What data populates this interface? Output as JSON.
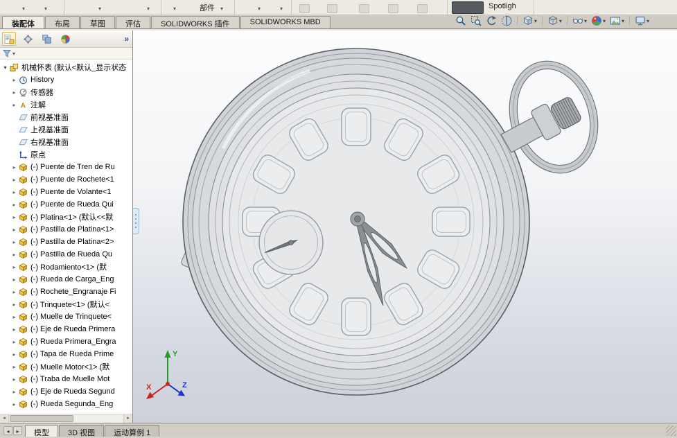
{
  "icons": {
    "caret": "▾",
    "chevrons": "»",
    "tab_prev": "◂",
    "tab_next": "▸"
  },
  "ribbon_partial": {
    "component_label": "部件",
    "spotlight_label": "Spotligh"
  },
  "command_tabs": {
    "tabs": [
      {
        "label": "装配体",
        "active": true
      },
      {
        "label": "布局"
      },
      {
        "label": "草图"
      },
      {
        "label": "评估"
      },
      {
        "label": "SOLIDWORKS 插件"
      },
      {
        "label": "SOLIDWORKS MBD"
      }
    ]
  },
  "view_toolbar": {
    "items": [
      {
        "icon": "zoom-fit"
      },
      {
        "icon": "zoom-area"
      },
      {
        "icon": "previous-view"
      },
      {
        "icon": "section-view"
      },
      {
        "sep": true
      },
      {
        "icon": "view-orientation",
        "caret": "▾"
      },
      {
        "sep": true
      },
      {
        "icon": "display-style",
        "caret": "▾"
      },
      {
        "sep": true
      },
      {
        "icon": "hide-show",
        "caret": "▾"
      },
      {
        "icon": "appearance",
        "caret": "▾"
      },
      {
        "icon": "scene",
        "caret": "▾"
      },
      {
        "sep": true
      },
      {
        "icon": "view-settings",
        "caret": "▾"
      }
    ]
  },
  "feature_panel": {
    "toolbar_icons": [
      {
        "icon": "pt-features",
        "active": true
      },
      {
        "icon": "pt-properties"
      },
      {
        "icon": "pt-configurations"
      },
      {
        "icon": "pt-display"
      }
    ],
    "tree": [
      {
        "label": "机械怀表 (默认<默认_显示状态",
        "icon": "assembly",
        "exp": "open",
        "cls": "lvl0"
      },
      {
        "label": "History",
        "icon": "history",
        "exp": "closed",
        "cls": "lvl1"
      },
      {
        "label": "传感器",
        "icon": "sensors",
        "exp": "closed",
        "cls": "lvl1"
      },
      {
        "label": "注解",
        "icon": "annotations",
        "exp": "closed",
        "cls": "lvl1"
      },
      {
        "label": "前视基准面",
        "icon": "plane",
        "exp": "none",
        "cls": "lvl1"
      },
      {
        "label": "上视基准面",
        "icon": "plane",
        "exp": "none",
        "cls": "lvl1"
      },
      {
        "label": "右视基准面",
        "icon": "plane",
        "exp": "none",
        "cls": "lvl1"
      },
      {
        "label": "原点",
        "icon": "origin",
        "exp": "none",
        "cls": "lvl1"
      },
      {
        "label": "(-) Puente de Tren de Ru",
        "icon": "part",
        "exp": "closed",
        "cls": "lvl1"
      },
      {
        "label": "(-) Puente de Rochete<1",
        "icon": "part",
        "exp": "closed",
        "cls": "lvl1"
      },
      {
        "label": "(-) Puente de Volante<1",
        "icon": "part",
        "exp": "closed",
        "cls": "lvl1"
      },
      {
        "label": "(-) Puente de Rueda Qui",
        "icon": "part",
        "exp": "closed",
        "cls": "lvl1"
      },
      {
        "label": "(-) Platina<1> (默认<<默",
        "icon": "part",
        "exp": "closed",
        "cls": "lvl1"
      },
      {
        "label": "(-) Pastilla de Platina<1>",
        "icon": "part",
        "exp": "closed",
        "cls": "lvl1"
      },
      {
        "label": "(-) Pastilla de Platina<2>",
        "icon": "part",
        "exp": "closed",
        "cls": "lvl1"
      },
      {
        "label": "(-) Pastilla de Rueda Qu",
        "icon": "part",
        "exp": "closed",
        "cls": "lvl1"
      },
      {
        "label": "(-) Rodamiento<1> (默",
        "icon": "part",
        "exp": "closed",
        "cls": "lvl1"
      },
      {
        "label": "(-) Rueda de Carga_Eng",
        "icon": "part",
        "exp": "closed",
        "cls": "lvl1"
      },
      {
        "label": "(-) Rochete_Engranaje Fi",
        "icon": "part",
        "exp": "closed",
        "cls": "lvl1"
      },
      {
        "label": "(-) Trinquete<1> (默认<",
        "icon": "part",
        "exp": "closed",
        "cls": "lvl1"
      },
      {
        "label": "(-) Muelle de Trinquete<",
        "icon": "part",
        "exp": "closed",
        "cls": "lvl1"
      },
      {
        "label": "(-) Eje de Rueda Primera",
        "icon": "part",
        "exp": "closed",
        "cls": "lvl1"
      },
      {
        "label": "(-) Rueda Primera_Engra",
        "icon": "part",
        "exp": "closed",
        "cls": "lvl1"
      },
      {
        "label": "(-) Tapa de Rueda Prime",
        "icon": "part",
        "exp": "closed",
        "cls": "lvl1"
      },
      {
        "label": "(-) Muelle Motor<1> (默",
        "icon": "part",
        "exp": "closed",
        "cls": "lvl1"
      },
      {
        "label": "(-) Traba de Muelle Mot",
        "icon": "part",
        "exp": "closed",
        "cls": "lvl1"
      },
      {
        "label": "(-) Eje de Rueda Segund",
        "icon": "part",
        "exp": "closed",
        "cls": "lvl1"
      },
      {
        "label": "(-) Rueda Segunda_Eng",
        "icon": "part",
        "exp": "closed",
        "cls": "lvl1"
      }
    ]
  },
  "viewport": {
    "triad": {
      "x_label": "X",
      "y_label": "Y",
      "z_label": "Z",
      "x_color": "#cc2222",
      "y_color": "#1f9e1f",
      "z_color": "#2233cc"
    }
  },
  "status_bar": {
    "tabs": [
      {
        "label": "模型",
        "active": true
      },
      {
        "label": "3D 视图"
      },
      {
        "label": "运动算例 1"
      }
    ]
  }
}
